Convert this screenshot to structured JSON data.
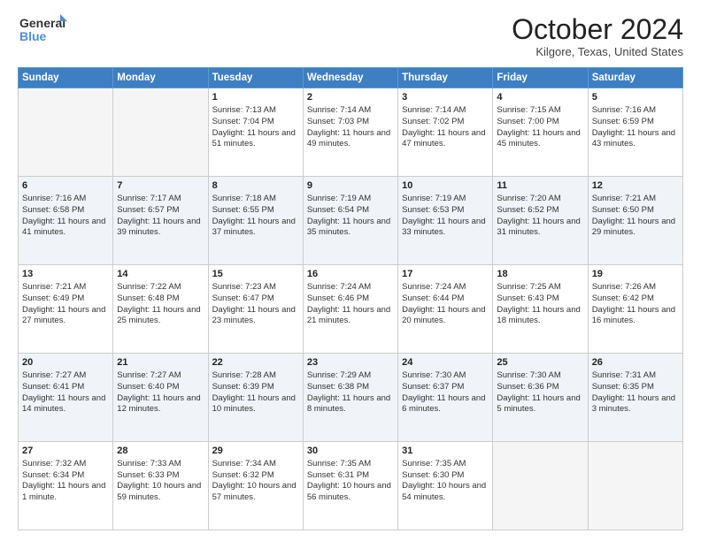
{
  "header": {
    "logo_line1": "General",
    "logo_line2": "Blue",
    "title": "October 2024",
    "location": "Kilgore, Texas, United States"
  },
  "days_of_week": [
    "Sunday",
    "Monday",
    "Tuesday",
    "Wednesday",
    "Thursday",
    "Friday",
    "Saturday"
  ],
  "weeks": [
    [
      {
        "day": "",
        "empty": true
      },
      {
        "day": "",
        "empty": true
      },
      {
        "day": "1",
        "sunrise": "Sunrise: 7:13 AM",
        "sunset": "Sunset: 7:04 PM",
        "daylight": "Daylight: 11 hours and 51 minutes."
      },
      {
        "day": "2",
        "sunrise": "Sunrise: 7:14 AM",
        "sunset": "Sunset: 7:03 PM",
        "daylight": "Daylight: 11 hours and 49 minutes."
      },
      {
        "day": "3",
        "sunrise": "Sunrise: 7:14 AM",
        "sunset": "Sunset: 7:02 PM",
        "daylight": "Daylight: 11 hours and 47 minutes."
      },
      {
        "day": "4",
        "sunrise": "Sunrise: 7:15 AM",
        "sunset": "Sunset: 7:00 PM",
        "daylight": "Daylight: 11 hours and 45 minutes."
      },
      {
        "day": "5",
        "sunrise": "Sunrise: 7:16 AM",
        "sunset": "Sunset: 6:59 PM",
        "daylight": "Daylight: 11 hours and 43 minutes."
      }
    ],
    [
      {
        "day": "6",
        "sunrise": "Sunrise: 7:16 AM",
        "sunset": "Sunset: 6:58 PM",
        "daylight": "Daylight: 11 hours and 41 minutes."
      },
      {
        "day": "7",
        "sunrise": "Sunrise: 7:17 AM",
        "sunset": "Sunset: 6:57 PM",
        "daylight": "Daylight: 11 hours and 39 minutes."
      },
      {
        "day": "8",
        "sunrise": "Sunrise: 7:18 AM",
        "sunset": "Sunset: 6:55 PM",
        "daylight": "Daylight: 11 hours and 37 minutes."
      },
      {
        "day": "9",
        "sunrise": "Sunrise: 7:19 AM",
        "sunset": "Sunset: 6:54 PM",
        "daylight": "Daylight: 11 hours and 35 minutes."
      },
      {
        "day": "10",
        "sunrise": "Sunrise: 7:19 AM",
        "sunset": "Sunset: 6:53 PM",
        "daylight": "Daylight: 11 hours and 33 minutes."
      },
      {
        "day": "11",
        "sunrise": "Sunrise: 7:20 AM",
        "sunset": "Sunset: 6:52 PM",
        "daylight": "Daylight: 11 hours and 31 minutes."
      },
      {
        "day": "12",
        "sunrise": "Sunrise: 7:21 AM",
        "sunset": "Sunset: 6:50 PM",
        "daylight": "Daylight: 11 hours and 29 minutes."
      }
    ],
    [
      {
        "day": "13",
        "sunrise": "Sunrise: 7:21 AM",
        "sunset": "Sunset: 6:49 PM",
        "daylight": "Daylight: 11 hours and 27 minutes."
      },
      {
        "day": "14",
        "sunrise": "Sunrise: 7:22 AM",
        "sunset": "Sunset: 6:48 PM",
        "daylight": "Daylight: 11 hours and 25 minutes."
      },
      {
        "day": "15",
        "sunrise": "Sunrise: 7:23 AM",
        "sunset": "Sunset: 6:47 PM",
        "daylight": "Daylight: 11 hours and 23 minutes."
      },
      {
        "day": "16",
        "sunrise": "Sunrise: 7:24 AM",
        "sunset": "Sunset: 6:46 PM",
        "daylight": "Daylight: 11 hours and 21 minutes."
      },
      {
        "day": "17",
        "sunrise": "Sunrise: 7:24 AM",
        "sunset": "Sunset: 6:44 PM",
        "daylight": "Daylight: 11 hours and 20 minutes."
      },
      {
        "day": "18",
        "sunrise": "Sunrise: 7:25 AM",
        "sunset": "Sunset: 6:43 PM",
        "daylight": "Daylight: 11 hours and 18 minutes."
      },
      {
        "day": "19",
        "sunrise": "Sunrise: 7:26 AM",
        "sunset": "Sunset: 6:42 PM",
        "daylight": "Daylight: 11 hours and 16 minutes."
      }
    ],
    [
      {
        "day": "20",
        "sunrise": "Sunrise: 7:27 AM",
        "sunset": "Sunset: 6:41 PM",
        "daylight": "Daylight: 11 hours and 14 minutes."
      },
      {
        "day": "21",
        "sunrise": "Sunrise: 7:27 AM",
        "sunset": "Sunset: 6:40 PM",
        "daylight": "Daylight: 11 hours and 12 minutes."
      },
      {
        "day": "22",
        "sunrise": "Sunrise: 7:28 AM",
        "sunset": "Sunset: 6:39 PM",
        "daylight": "Daylight: 11 hours and 10 minutes."
      },
      {
        "day": "23",
        "sunrise": "Sunrise: 7:29 AM",
        "sunset": "Sunset: 6:38 PM",
        "daylight": "Daylight: 11 hours and 8 minutes."
      },
      {
        "day": "24",
        "sunrise": "Sunrise: 7:30 AM",
        "sunset": "Sunset: 6:37 PM",
        "daylight": "Daylight: 11 hours and 6 minutes."
      },
      {
        "day": "25",
        "sunrise": "Sunrise: 7:30 AM",
        "sunset": "Sunset: 6:36 PM",
        "daylight": "Daylight: 11 hours and 5 minutes."
      },
      {
        "day": "26",
        "sunrise": "Sunrise: 7:31 AM",
        "sunset": "Sunset: 6:35 PM",
        "daylight": "Daylight: 11 hours and 3 minutes."
      }
    ],
    [
      {
        "day": "27",
        "sunrise": "Sunrise: 7:32 AM",
        "sunset": "Sunset: 6:34 PM",
        "daylight": "Daylight: 11 hours and 1 minute."
      },
      {
        "day": "28",
        "sunrise": "Sunrise: 7:33 AM",
        "sunset": "Sunset: 6:33 PM",
        "daylight": "Daylight: 10 hours and 59 minutes."
      },
      {
        "day": "29",
        "sunrise": "Sunrise: 7:34 AM",
        "sunset": "Sunset: 6:32 PM",
        "daylight": "Daylight: 10 hours and 57 minutes."
      },
      {
        "day": "30",
        "sunrise": "Sunrise: 7:35 AM",
        "sunset": "Sunset: 6:31 PM",
        "daylight": "Daylight: 10 hours and 56 minutes."
      },
      {
        "day": "31",
        "sunrise": "Sunrise: 7:35 AM",
        "sunset": "Sunset: 6:30 PM",
        "daylight": "Daylight: 10 hours and 54 minutes."
      },
      {
        "day": "",
        "empty": true
      },
      {
        "day": "",
        "empty": true
      }
    ]
  ]
}
